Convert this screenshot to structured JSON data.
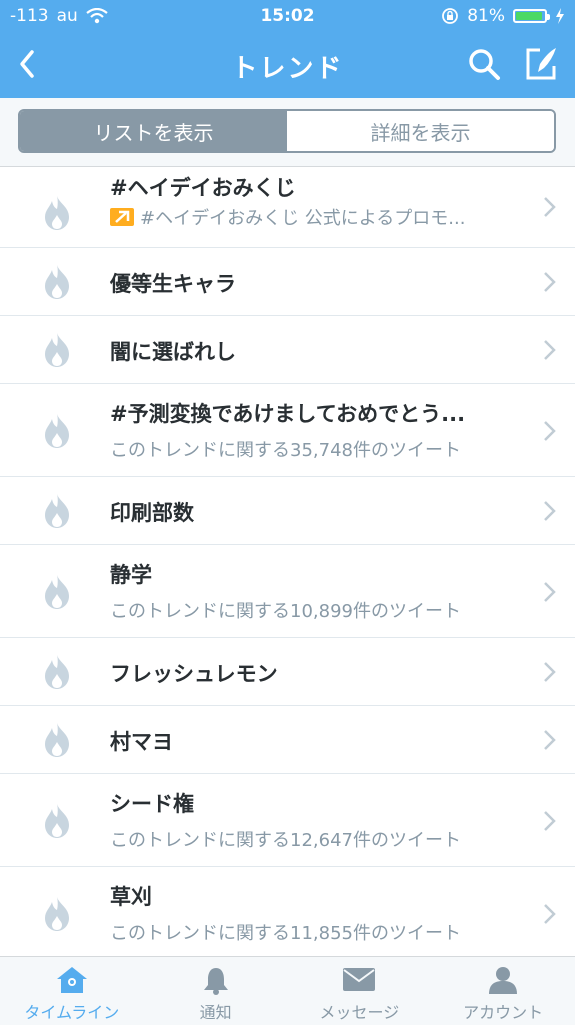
{
  "status": {
    "signal": "-113",
    "carrier": "au",
    "time": "15:02",
    "battery": "81%",
    "battery_level": 0.81
  },
  "nav": {
    "title": "トレンド"
  },
  "segments": {
    "list": "リストを表示",
    "detail": "詳細を表示"
  },
  "trends": [
    {
      "name": "#ヘイデイおみくじ",
      "sub": "#ヘイデイおみくじ 公式によるプロモ...",
      "promoted": true
    },
    {
      "name": "優等生キャラ",
      "sub": ""
    },
    {
      "name": "闇に選ばれし",
      "sub": ""
    },
    {
      "name": "#予測変換であけましておめでとう...",
      "sub": "このトレンドに関する35,748件のツイート"
    },
    {
      "name": "印刷部数",
      "sub": ""
    },
    {
      "name": "静学",
      "sub": "このトレンドに関する10,899件のツイート"
    },
    {
      "name": "フレッシュレモン",
      "sub": ""
    },
    {
      "name": "村マヨ",
      "sub": ""
    },
    {
      "name": "シード権",
      "sub": "このトレンドに関する12,647件のツイート"
    },
    {
      "name": "草刈",
      "sub": "このトレンドに関する11,855件のツイート"
    }
  ],
  "tabs": {
    "timeline": "タイムライン",
    "notifications": "通知",
    "messages": "メッセージ",
    "account": "アカウント"
  },
  "colors": {
    "brand": "#55acee",
    "muted": "#8899a6",
    "battery": "#4cd964",
    "promo": "#ffad1f"
  },
  "icons": [
    "back-icon",
    "search-icon",
    "compose-icon",
    "flame-icon",
    "chevron-right-icon",
    "promoted-icon",
    "home-icon",
    "bell-icon",
    "envelope-icon",
    "person-icon"
  ]
}
